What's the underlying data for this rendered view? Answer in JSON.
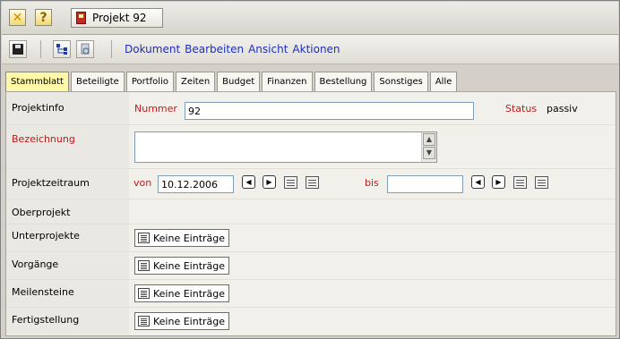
{
  "titlebar": {
    "project_label": "Projekt 92"
  },
  "toolbar": {
    "menu": [
      "Dokument",
      "Bearbeiten",
      "Ansicht",
      "Aktionen"
    ]
  },
  "tabs": [
    "Stammblatt",
    "Beteiligte",
    "Portfolio",
    "Zeiten",
    "Budget",
    "Finanzen",
    "Bestellung",
    "Sonstiges",
    "Alle"
  ],
  "active_tab": "Stammblatt",
  "form": {
    "projektinfo_label": "Projektinfo",
    "nummer_label": "Nummer",
    "nummer_value": "92",
    "status_label": "Status",
    "status_value": "passiv",
    "bezeichnung_label": "Bezeichnung",
    "bezeichnung_value": "",
    "zeitraum_label": "Projektzeitraum",
    "von_label": "von",
    "von_value": "10.12.2006",
    "bis_label": "bis",
    "bis_value": "",
    "oberprojekt_label": "Oberprojekt",
    "unterprojekte_label": "Unterprojekte",
    "vorgaenge_label": "Vorgänge",
    "meilensteine_label": "Meilensteine",
    "fertigstellung_label": "Fertigstellung",
    "keine_eintraege": "Keine Einträge"
  },
  "colors": {
    "active_tab": "#fff8a8",
    "required_label": "#c01a1a",
    "menu_link": "#1f2fb7"
  }
}
